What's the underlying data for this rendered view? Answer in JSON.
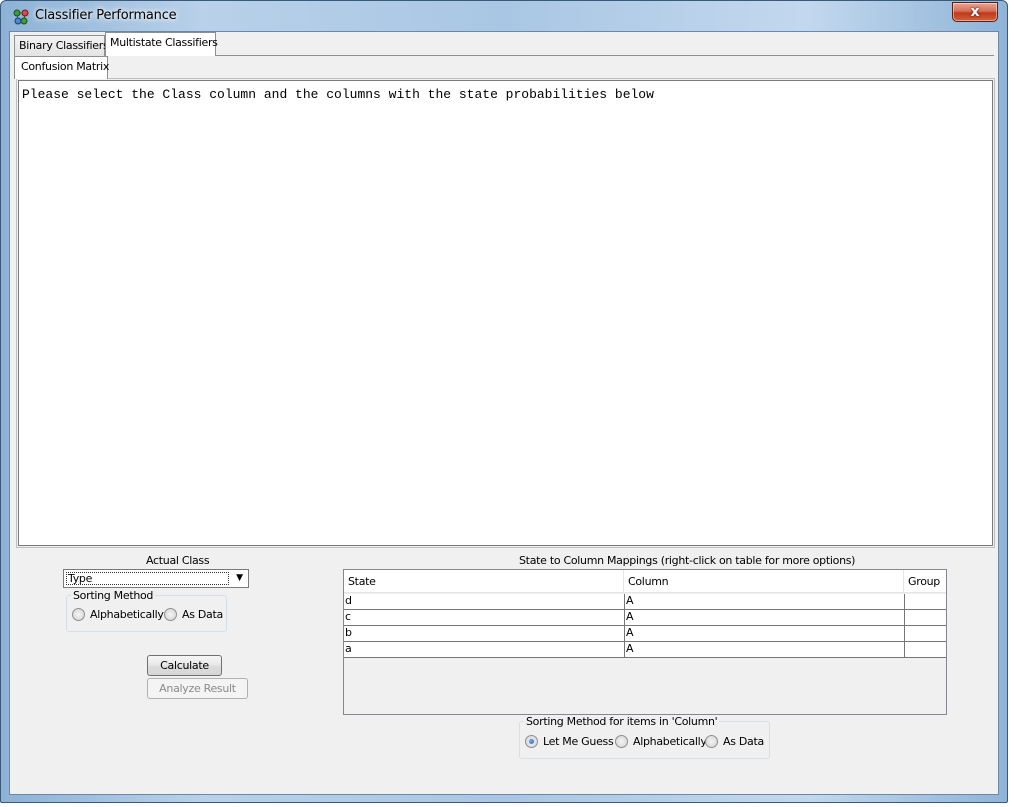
{
  "window": {
    "title": "Classifier Performance",
    "close_symbol": "x"
  },
  "tabs": [
    {
      "label": "Binary Classifiers",
      "selected": false
    },
    {
      "label": "Multistate Classifiers",
      "selected": true
    }
  ],
  "inner_tabs": [
    {
      "label": "Confusion Matrix",
      "selected": true
    }
  ],
  "message": "Please select the Class column and the columns with the state probabilities below",
  "actual_class": {
    "label": "Actual Class",
    "selected": "Type",
    "sorting": {
      "legend": "Sorting Method",
      "options": [
        {
          "label": "Alphabetically",
          "checked": false
        },
        {
          "label": "As Data",
          "checked": false
        }
      ]
    }
  },
  "buttons": {
    "calculate": "Calculate",
    "analyze": "Analyze Result"
  },
  "mappings": {
    "title": "State to Column Mappings (right-click on table for more options)",
    "columns": [
      "State",
      "Column",
      "Group"
    ],
    "rows": [
      {
        "state": "d",
        "column": "A",
        "group": ""
      },
      {
        "state": "c",
        "column": "A",
        "group": ""
      },
      {
        "state": "b",
        "column": "A",
        "group": ""
      },
      {
        "state": "a",
        "column": "A",
        "group": ""
      }
    ],
    "sorting": {
      "legend": "Sorting Method for items in 'Column'",
      "options": [
        {
          "label": "Let Me Guess",
          "checked": true
        },
        {
          "label": "Alphabetically",
          "checked": false
        },
        {
          "label": "As Data",
          "checked": false
        }
      ]
    }
  },
  "colors": {
    "frame": "#a9c6e4",
    "client": "#f0f0f0",
    "close": "#c0391b"
  }
}
